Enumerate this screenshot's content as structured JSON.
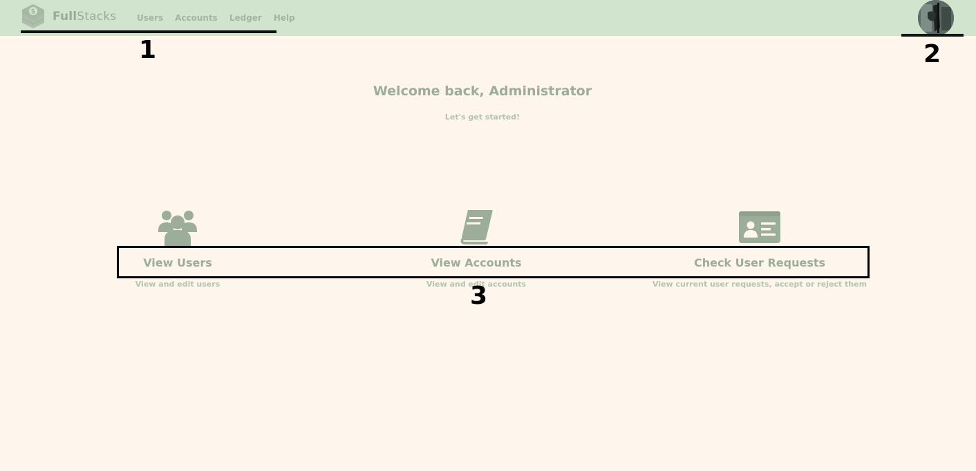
{
  "app": {
    "brand_bold": "Full",
    "brand_rest": "Stacks",
    "brand_color": "#9aaa98",
    "nav_bg_color": "#d1e5ce",
    "page_bg_color": "#fef5ec"
  },
  "nav": {
    "links": [
      {
        "label": "Users"
      },
      {
        "label": "Accounts"
      },
      {
        "label": "Ledger"
      },
      {
        "label": "Help"
      }
    ]
  },
  "markers": {
    "m1": "1",
    "m2": "2",
    "m3": "3"
  },
  "welcome": {
    "title": "Welcome back, Administrator",
    "subtitle": "Let's get started!"
  },
  "features": [
    {
      "icon": "users-icon",
      "title": "View Users",
      "desc": "View and edit users"
    },
    {
      "icon": "book-icon",
      "title": "View Accounts",
      "desc": "View and edit accounts"
    },
    {
      "icon": "id-card-icon",
      "title": "Check User Requests",
      "desc": "View current user requests, accept or reject them"
    }
  ],
  "icon_color": "#9cad99"
}
